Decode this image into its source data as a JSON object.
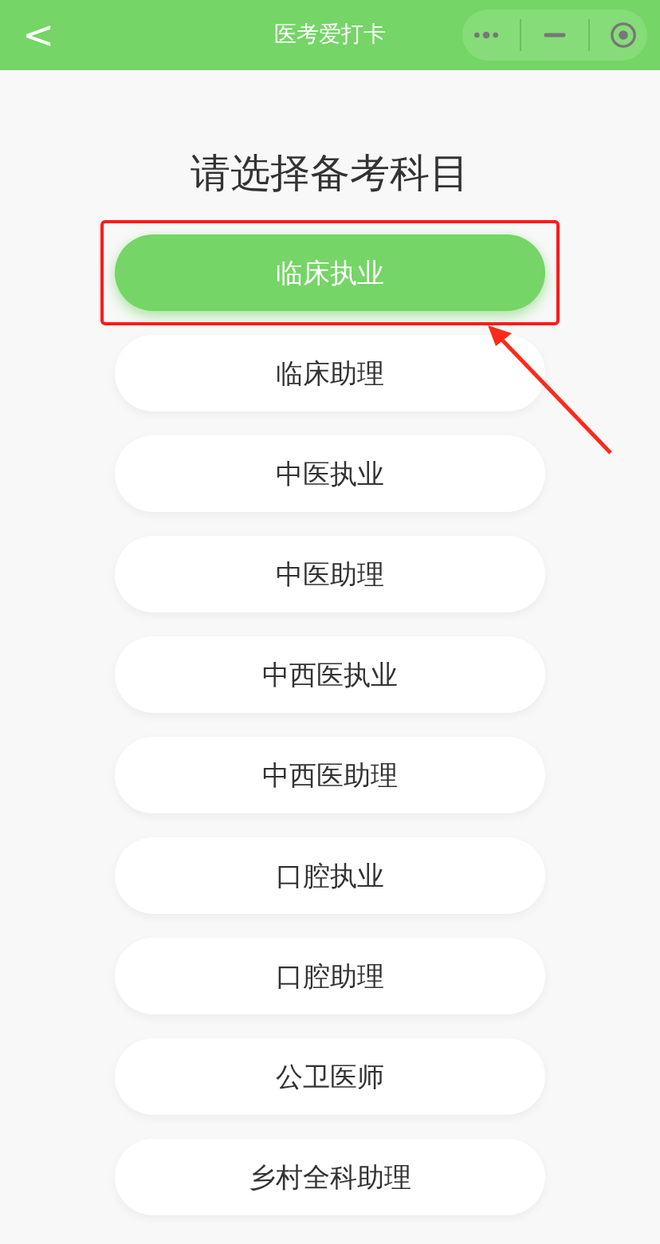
{
  "nav_bar": {
    "back": "<",
    "title": "医考爱打卡"
  },
  "heading": "请选择备考科目",
  "options": [
    {
      "label": "临床执业",
      "selected": true
    },
    {
      "label": "临床助理",
      "selected": false
    },
    {
      "label": "中医执业",
      "selected": false
    },
    {
      "label": "中医助理",
      "selected": false
    },
    {
      "label": "中西医执业",
      "selected": false
    },
    {
      "label": "中西医助理",
      "selected": false
    },
    {
      "label": "口腔执业",
      "selected": false
    },
    {
      "label": "口腔助理",
      "selected": false
    },
    {
      "label": "公卫医师",
      "selected": false
    },
    {
      "label": "乡村全科助理",
      "selected": false
    }
  ]
}
